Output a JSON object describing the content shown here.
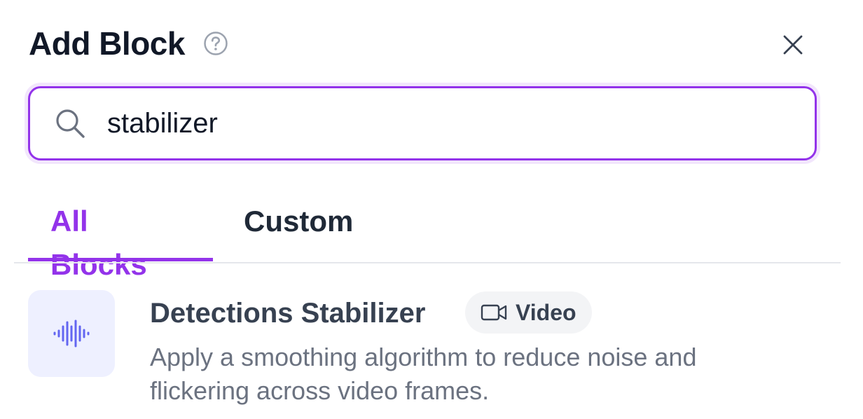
{
  "header": {
    "title": "Add Block",
    "help_icon": "question-circle-icon",
    "close_icon": "close-x-icon"
  },
  "search": {
    "value": "stabilizer",
    "icon": "search-icon"
  },
  "tabs": [
    {
      "label": "All Blocks",
      "active": true
    },
    {
      "label": "Custom",
      "active": false
    }
  ],
  "results": [
    {
      "title": "Detections Stabilizer",
      "icon": "waveform-icon",
      "badge": {
        "label": "Video",
        "icon": "video-camera-icon"
      },
      "description": "Apply a smoothing algorithm to reduce noise and flickering across video frames."
    }
  ],
  "colors": {
    "accent": "#9333ea",
    "title_text": "#111827",
    "body_text": "#6b7280",
    "icon_tile_bg": "#eef0ff",
    "waveform": "#6366f1",
    "badge_bg": "#f3f4f6"
  }
}
